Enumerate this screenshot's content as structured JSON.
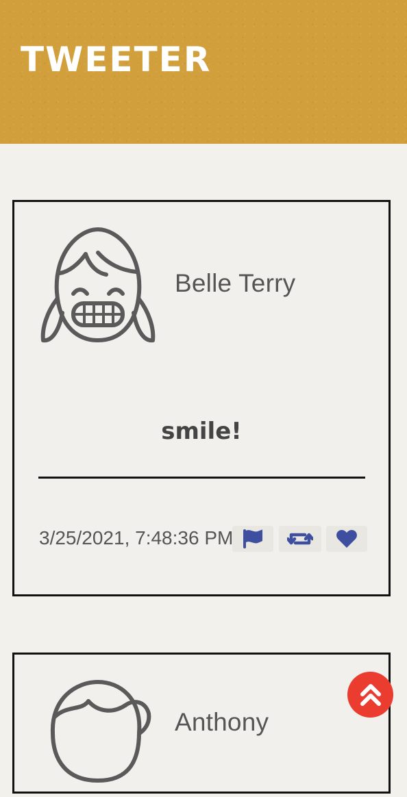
{
  "header": {
    "brand": "Tweeter",
    "background_color": "#d19f3c"
  },
  "tweets": [
    {
      "author": "Belle Terry",
      "avatar_icon": "grinning-girl-avatar-icon",
      "content": "smile!",
      "timestamp": "3/25/2021, 7:48:36 PM",
      "actions": {
        "flag_icon": "flag-icon",
        "retweet_icon": "retweet-icon",
        "like_icon": "heart-icon",
        "color": "#3f4fa0"
      }
    },
    {
      "author": "Anthony",
      "avatar_icon": "ponytail-person-avatar-icon"
    }
  ],
  "back_to_top": {
    "icon": "double-chevron-up-icon",
    "color": "#ea3d2f"
  }
}
